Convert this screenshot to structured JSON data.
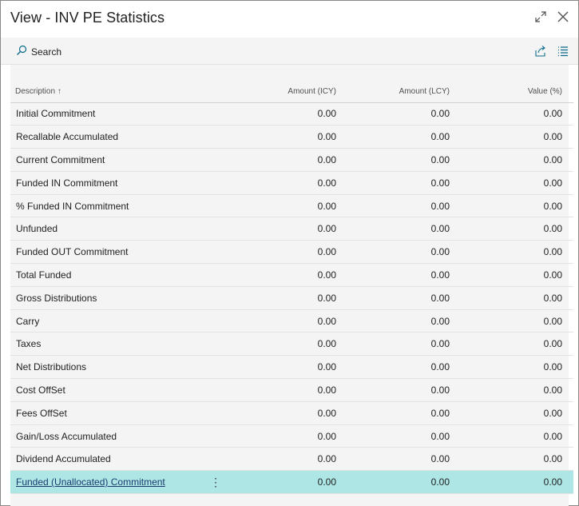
{
  "window": {
    "title": "View - INV PE Statistics"
  },
  "toolbar": {
    "search_label": "Search"
  },
  "table": {
    "headers": {
      "description": "Description",
      "sort_indicator": "↑",
      "amount_icy": "Amount (ICY)",
      "amount_lcy": "Amount (LCY)",
      "value_pct": "Value (%)"
    },
    "rows": [
      {
        "description": "Initial Commitment",
        "amount_icy": "0.00",
        "amount_lcy": "0.00",
        "value_pct": "0.00"
      },
      {
        "description": "Recallable Accumulated",
        "amount_icy": "0.00",
        "amount_lcy": "0.00",
        "value_pct": "0.00"
      },
      {
        "description": "Current Commitment",
        "amount_icy": "0.00",
        "amount_lcy": "0.00",
        "value_pct": "0.00"
      },
      {
        "description": "Funded IN Commitment",
        "amount_icy": "0.00",
        "amount_lcy": "0.00",
        "value_pct": "0.00"
      },
      {
        "description": "% Funded IN Commitment",
        "amount_icy": "0.00",
        "amount_lcy": "0.00",
        "value_pct": "0.00"
      },
      {
        "description": "Unfunded",
        "amount_icy": "0.00",
        "amount_lcy": "0.00",
        "value_pct": "0.00"
      },
      {
        "description": "Funded OUT Commitment",
        "amount_icy": "0.00",
        "amount_lcy": "0.00",
        "value_pct": "0.00"
      },
      {
        "description": "Total Funded",
        "amount_icy": "0.00",
        "amount_lcy": "0.00",
        "value_pct": "0.00"
      },
      {
        "description": "Gross Distributions",
        "amount_icy": "0.00",
        "amount_lcy": "0.00",
        "value_pct": "0.00"
      },
      {
        "description": "Carry",
        "amount_icy": "0.00",
        "amount_lcy": "0.00",
        "value_pct": "0.00"
      },
      {
        "description": "Taxes",
        "amount_icy": "0.00",
        "amount_lcy": "0.00",
        "value_pct": "0.00"
      },
      {
        "description": "Net Distributions",
        "amount_icy": "0.00",
        "amount_lcy": "0.00",
        "value_pct": "0.00"
      },
      {
        "description": "Cost OffSet",
        "amount_icy": "0.00",
        "amount_lcy": "0.00",
        "value_pct": "0.00"
      },
      {
        "description": "Fees OffSet",
        "amount_icy": "0.00",
        "amount_lcy": "0.00",
        "value_pct": "0.00"
      },
      {
        "description": "Gain/Loss Accumulated",
        "amount_icy": "0.00",
        "amount_lcy": "0.00",
        "value_pct": "0.00"
      },
      {
        "description": "Dividend Accumulated",
        "amount_icy": "0.00",
        "amount_lcy": "0.00",
        "value_pct": "0.00"
      },
      {
        "description": "Funded (Unallocated) Commitment",
        "amount_icy": "0.00",
        "amount_lcy": "0.00",
        "value_pct": "0.00",
        "selected": true,
        "row_menu": "⋮"
      }
    ]
  },
  "colors": {
    "selected_row": "#aee6e6",
    "accent": "#0078d4",
    "link": "#1a3a6e"
  },
  "icons": [
    "expand-icon",
    "close-icon",
    "search-icon",
    "share-icon",
    "list-view-icon",
    "row-menu-icon"
  ]
}
